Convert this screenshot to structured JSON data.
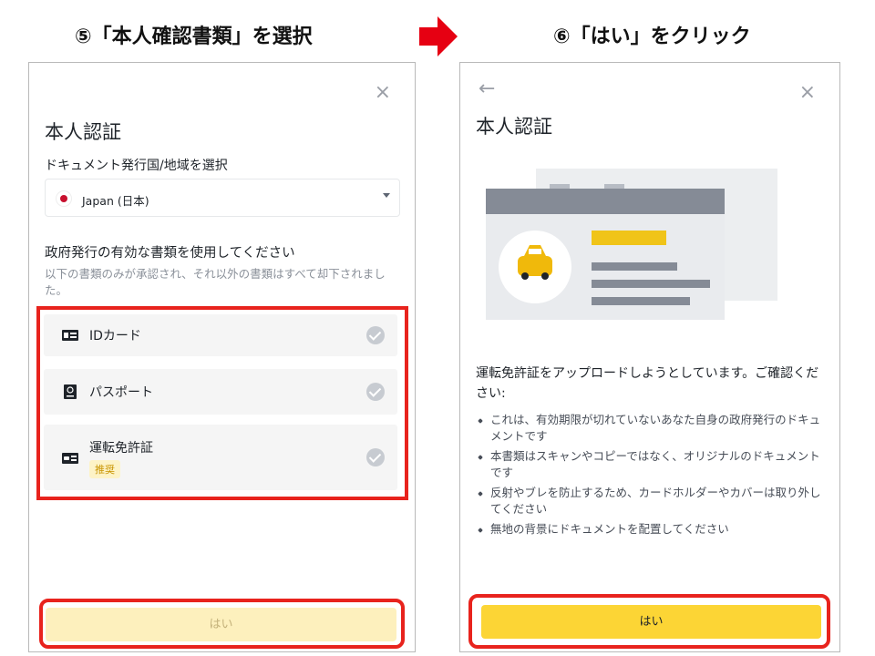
{
  "steps": {
    "left_title": "⑤「本人確認書類」を選択",
    "right_title": "⑥「はい」をクリック"
  },
  "colors": {
    "highlight": "#e8231d",
    "primary": "#fcd535",
    "arrow": "#e60012"
  },
  "left_panel": {
    "close_icon": "×",
    "title": "本人認証",
    "country_label": "ドキュメント発行国/地域を選択",
    "country_value": "Japan (日本)",
    "doc_heading": "政府発行の有効な書類を使用してください",
    "doc_note": "以下の書類のみが承認され、それ以外の書類はすべて却下されました。",
    "documents": [
      {
        "label": "IDカード",
        "icon": "id-card-icon"
      },
      {
        "label": "パスポート",
        "icon": "passport-icon"
      },
      {
        "label": "運転免許証",
        "icon": "driver-license-icon",
        "badge": "推奨"
      }
    ],
    "button_label": "はい"
  },
  "right_panel": {
    "back_icon": "←",
    "close_icon": "×",
    "title": "本人認証",
    "intro": "運転免許証をアップロードしようとしています。ご確認ください:",
    "bullets": [
      "これは、有効期限が切れていないあなた自身の政府発行のドキュメントです",
      "本書類はスキャンやコピーではなく、オリジナルのドキュメントです",
      "反射やブレを防止するため、カードホルダーやカバーは取り外してください",
      "無地の背景にドキュメントを配置してください"
    ],
    "button_label": "はい"
  }
}
